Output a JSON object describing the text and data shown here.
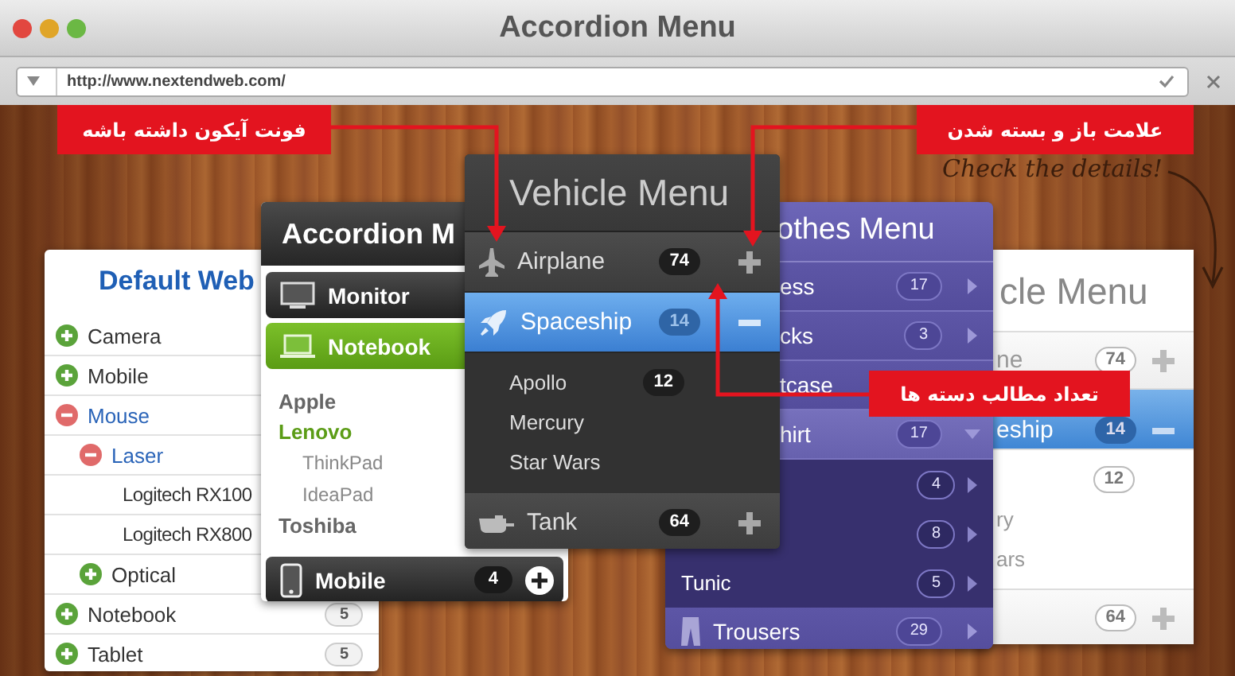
{
  "window": {
    "title": "Accordion Menu"
  },
  "address_bar": {
    "url": "http://www.nextendweb.com/"
  },
  "annotations": [
    {
      "text": "علامت باز و بسته شدن"
    },
    {
      "text": "فونت آیکون داشته باشه"
    },
    {
      "text": "تعداد مطالب دسته ها"
    }
  ],
  "handwriting": "Check the details!",
  "default_menu": {
    "title": "Default Web",
    "items": [
      {
        "label": "Camera",
        "expanded": false
      },
      {
        "label": "Mobile",
        "expanded": false
      },
      {
        "label": "Mouse",
        "expanded": true,
        "children": [
          {
            "label": "Laser",
            "expanded": true,
            "children": [
              {
                "label": "Logitech RX100"
              },
              {
                "label": "Logitech RX800"
              }
            ]
          },
          {
            "label": "Optical",
            "expanded": false
          }
        ]
      },
      {
        "label": "Notebook",
        "expanded": false,
        "count": "5"
      },
      {
        "label": "Tablet",
        "expanded": false,
        "count": "5"
      }
    ]
  },
  "accordion_menu": {
    "title": "Accordion M",
    "sections": [
      {
        "label": "Monitor",
        "kind": "monitor",
        "expanded": false
      },
      {
        "label": "Notebook",
        "kind": "laptop",
        "expanded": true,
        "items": [
          {
            "label": "Apple",
            "selected": false
          },
          {
            "label": "Lenovo",
            "selected": true,
            "children": [
              {
                "label": "ThinkPad"
              },
              {
                "label": "IdeaPad"
              }
            ]
          },
          {
            "label": "Toshiba",
            "selected": false
          }
        ]
      },
      {
        "label": "Mobile",
        "kind": "phone",
        "expanded": false,
        "count": "4"
      }
    ]
  },
  "vehicle_menu": {
    "title": "Vehicle Menu",
    "items": [
      {
        "label": "Airplane",
        "kind": "plane",
        "count": "74",
        "expanded": false
      },
      {
        "label": "Spaceship",
        "kind": "rocket",
        "count": "14",
        "expanded": true,
        "children": [
          {
            "label": "Apollo",
            "count": "12"
          },
          {
            "label": "Mercury"
          },
          {
            "label": "Star Wars"
          }
        ]
      },
      {
        "label": "Tank",
        "kind": "tank",
        "count": "64",
        "expanded": false
      }
    ]
  },
  "clothes_menu": {
    "title": "othes Menu",
    "items": [
      {
        "label": "ess",
        "count": "17",
        "expanded": false
      },
      {
        "label": "cks",
        "count": "3",
        "expanded": false
      },
      {
        "label": "tcase",
        "expanded": false
      },
      {
        "label": "hirt",
        "count": "17",
        "expanded": true,
        "children": [
          {
            "count": "4"
          },
          {
            "count": "8"
          },
          {
            "label": "Tunic",
            "count": "5"
          }
        ]
      },
      {
        "label": "Trousers",
        "kind": "trousers",
        "count": "29",
        "expanded": false
      }
    ]
  },
  "white_vehicle_menu": {
    "title": "cle Menu",
    "items": [
      {
        "label": "ne",
        "count": "74",
        "expanded": false
      },
      {
        "label": "eship",
        "count": "14",
        "expanded": true,
        "children": [
          {
            "count": "12"
          },
          {
            "label": "ry"
          },
          {
            "label": "ars"
          }
        ]
      },
      {
        "count": "64",
        "expanded": false
      }
    ]
  }
}
